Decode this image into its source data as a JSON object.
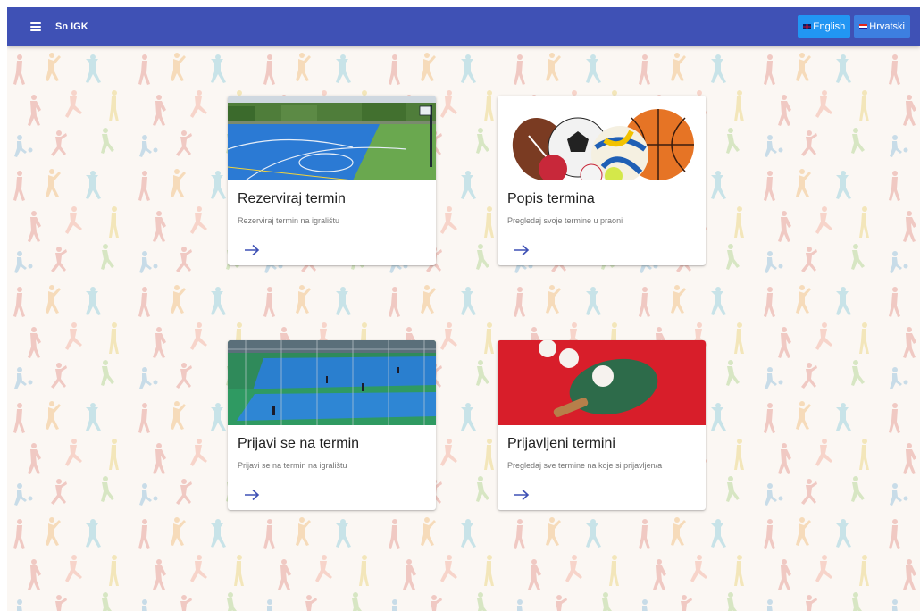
{
  "app": {
    "title": "Sn IGK",
    "menu_icon": "hamburger-menu-icon"
  },
  "languages": [
    {
      "label": "English",
      "flag": "uk-flag-icon",
      "active": true
    },
    {
      "label": "Hrvatski",
      "flag": "croatia-flag-icon",
      "active": false
    }
  ],
  "cards": [
    {
      "title": "Rezerviraj termin",
      "subtitle": "Rezerviraj termin na igralištu",
      "image": "outdoor-basketball-court-image",
      "action_icon": "arrow-right-icon"
    },
    {
      "title": "Popis termina",
      "subtitle": "Pregledaj svoje termine u praoni",
      "image": "sports-balls-image",
      "action_icon": "arrow-right-icon"
    },
    {
      "title": "Prijavi se na termin",
      "subtitle": "Prijavi se na termin na igralištu",
      "image": "fenced-sports-court-image",
      "action_icon": "arrow-right-icon"
    },
    {
      "title": "Prijavljeni termini",
      "subtitle": "Pregledaj sve termine na koje si prijavljen/a",
      "image": "table-tennis-paddle-image",
      "action_icon": "arrow-right-icon"
    }
  ],
  "colors": {
    "appbar": "#3f51b5",
    "language_button": "#2196f3",
    "arrow": "#3f51b5"
  }
}
